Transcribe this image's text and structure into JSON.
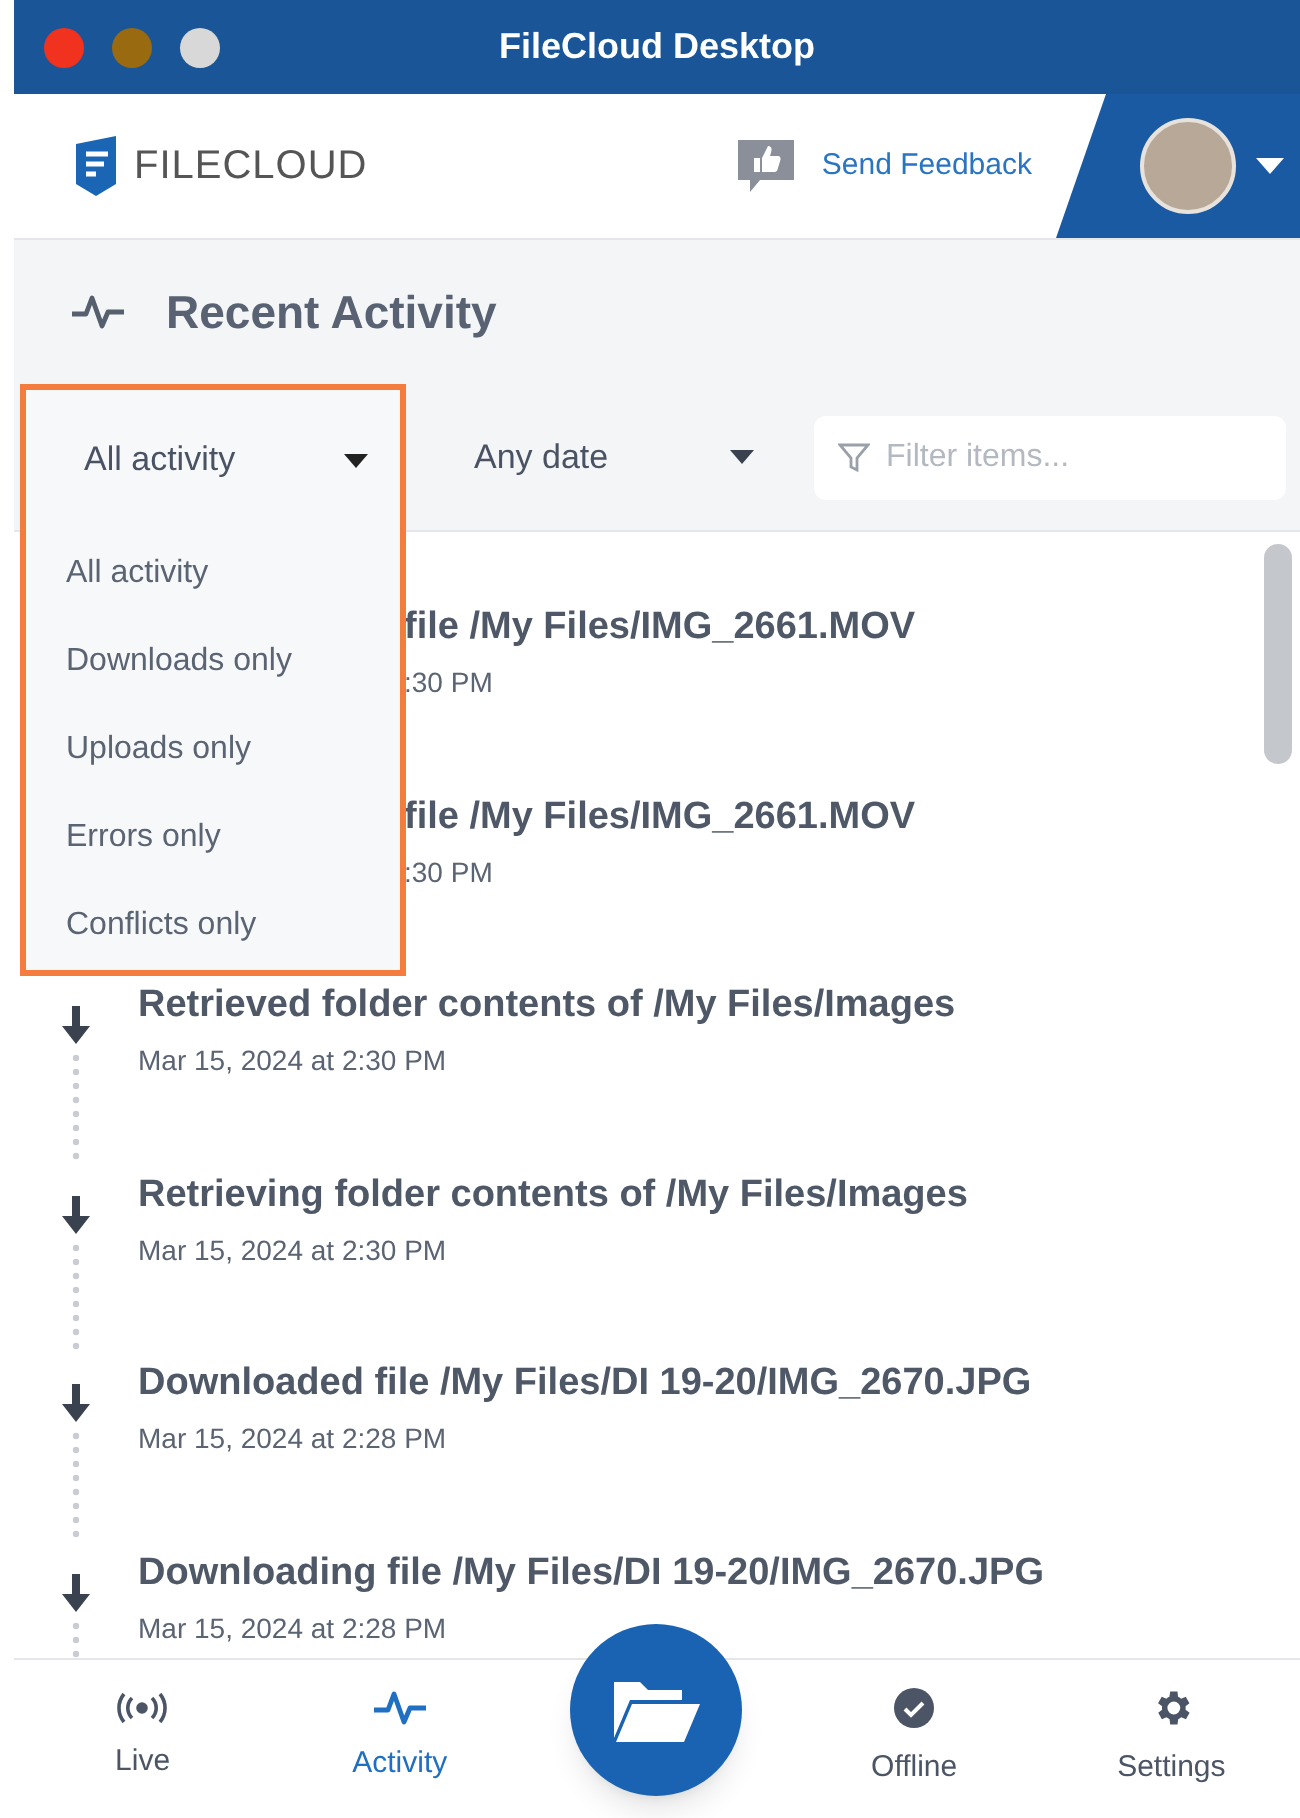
{
  "window": {
    "title": "FileCloud Desktop"
  },
  "header": {
    "logo_text": "FILECLOUD",
    "feedback": "Send Feedback"
  },
  "section": {
    "title": "Recent Activity"
  },
  "filters": {
    "type": {
      "value": "All activity",
      "expanded": true,
      "options": [
        {
          "label": "All activity"
        },
        {
          "label": "Downloads only"
        },
        {
          "label": "Uploads only"
        },
        {
          "label": "Errors only"
        },
        {
          "label": "Conflicts only"
        }
      ]
    },
    "date": {
      "value": "Any date"
    },
    "search": {
      "placeholder": "Filter items..."
    }
  },
  "activity": [
    {
      "kind": "covered",
      "title": "file /My Files/IMG_2661.MOV",
      "time": ":30 PM"
    },
    {
      "kind": "covered",
      "title": "file /My Files/IMG_2661.MOV",
      "time": ":30 PM"
    },
    {
      "kind": "full",
      "title": "Retrieved folder contents of /My Files/Images",
      "time": "Mar 15, 2024 at 2:30 PM"
    },
    {
      "kind": "full",
      "title": "Retrieving folder contents of /My Files/Images",
      "time": "Mar 15, 2024 at 2:30 PM"
    },
    {
      "kind": "full",
      "title": "Downloaded file /My Files/DI 19-20/IMG_2670.JPG",
      "time": "Mar 15, 2024 at 2:28 PM"
    },
    {
      "kind": "full",
      "title": "Downloading file /My Files/DI 19-20/IMG_2670.JPG",
      "time": "Mar 15, 2024 at 2:28 PM"
    }
  ],
  "nav": [
    {
      "kind": "live",
      "label": "Live",
      "selected": false
    },
    {
      "kind": "activity",
      "label": "Activity",
      "selected": true
    },
    {
      "kind": "folder",
      "selected": false
    },
    {
      "kind": "offline",
      "label": "Offline",
      "selected": false
    },
    {
      "kind": "settings",
      "label": "Settings",
      "selected": false
    }
  ]
}
